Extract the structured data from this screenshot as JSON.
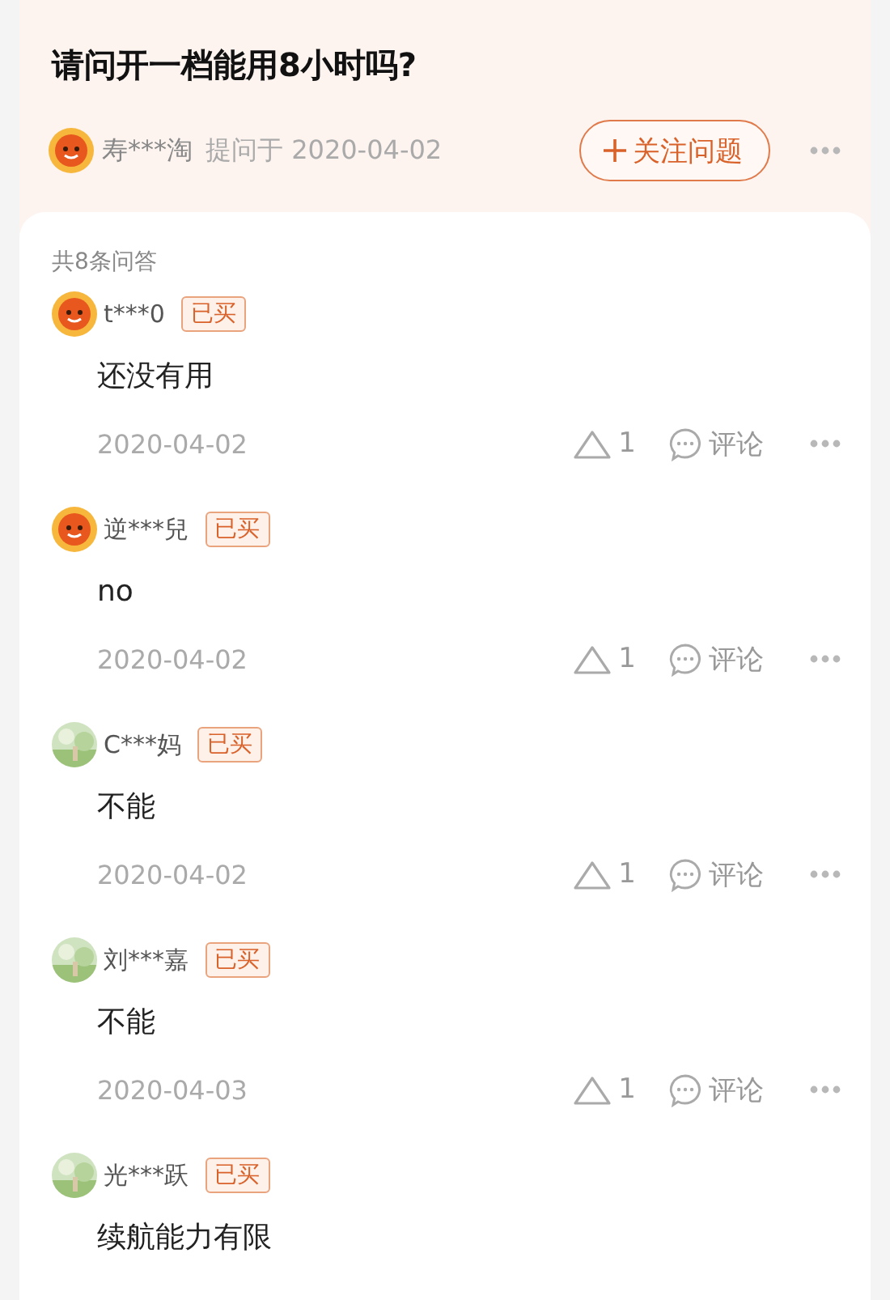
{
  "question": {
    "title": "请问开一档能用8小时吗?",
    "asker": {
      "name": "寿***淘",
      "avatar": {
        "kind": "mascot"
      }
    },
    "asked_label": "提问于 2020-04-02",
    "follow_button": "关注问题"
  },
  "answer_count": "共8条问答",
  "answers": [
    {
      "user": "t***0",
      "avatar": {
        "kind": "mascot"
      },
      "badge": "已买",
      "text": "还没有用",
      "date": "2020-04-02",
      "likes": "1",
      "comment_label": "评论"
    },
    {
      "user": "逆***兒",
      "avatar": {
        "kind": "mascot"
      },
      "badge": "已买",
      "text": "no",
      "date": "2020-04-02",
      "likes": "1",
      "comment_label": "评论"
    },
    {
      "user": "C***妈",
      "badge": "已买",
      "text": "不能",
      "date": "2020-04-02",
      "likes": "1",
      "comment_label": "评论"
    },
    {
      "user": "刘***嘉",
      "badge": "已买",
      "text": "不能",
      "date": "2020-04-03",
      "likes": "1",
      "comment_label": "评论"
    },
    {
      "user": "光***跃",
      "badge": "已买",
      "text": "续航能力有限"
    }
  ]
}
